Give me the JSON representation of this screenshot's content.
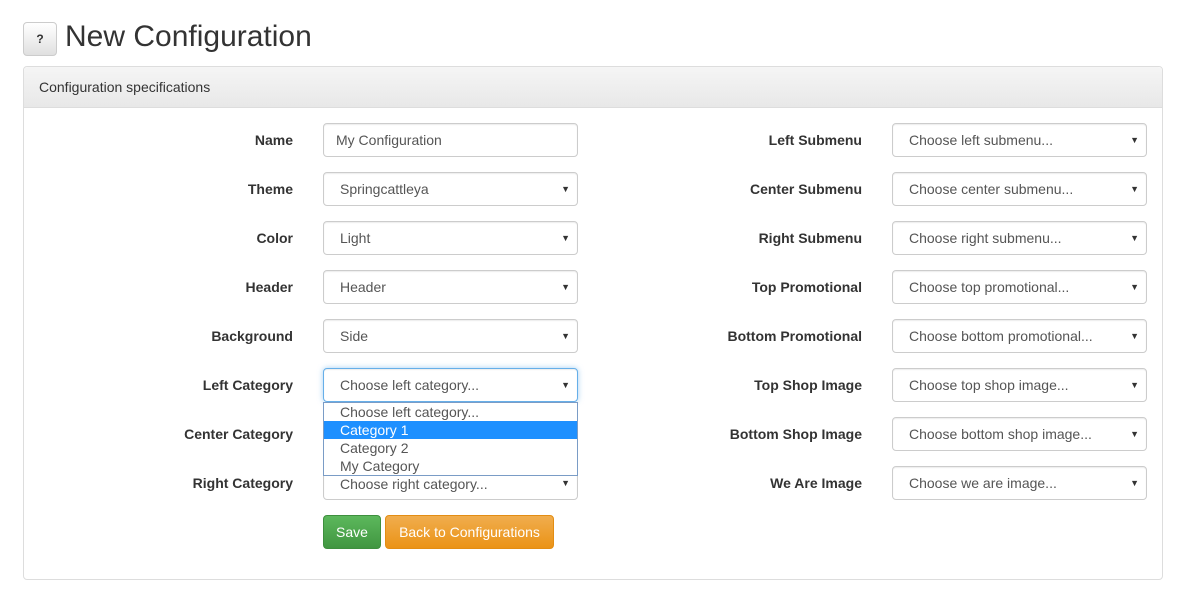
{
  "header": {
    "help_label": "?",
    "title": "New Configuration"
  },
  "panel": {
    "heading": "Configuration specifications"
  },
  "left_fields": [
    {
      "label": "Name",
      "value": "My Configuration",
      "type": "text"
    },
    {
      "label": "Theme",
      "value": "Springcattleya",
      "type": "select"
    },
    {
      "label": "Color",
      "value": "Light",
      "type": "select"
    },
    {
      "label": "Header",
      "value": "Header",
      "type": "select"
    },
    {
      "label": "Background",
      "value": "Side",
      "type": "select"
    },
    {
      "label": "Left Category",
      "value": "Choose left category...",
      "type": "select"
    },
    {
      "label": "Center Category",
      "value": "",
      "type": "select"
    },
    {
      "label": "Right Category",
      "value": "Choose right category...",
      "type": "select"
    }
  ],
  "right_fields": [
    {
      "label": "Left Submenu",
      "value": "Choose left submenu..."
    },
    {
      "label": "Center Submenu",
      "value": "Choose center submenu..."
    },
    {
      "label": "Right Submenu",
      "value": "Choose right submenu..."
    },
    {
      "label": "Top Promotional",
      "value": "Choose top promotional..."
    },
    {
      "label": "Bottom Promotional",
      "value": "Choose bottom promotional..."
    },
    {
      "label": "Top Shop Image",
      "value": "Choose top shop image..."
    },
    {
      "label": "Bottom Shop Image",
      "value": "Choose bottom shop image..."
    },
    {
      "label": "We Are Image",
      "value": "Choose we are image..."
    }
  ],
  "left_category_dropdown": {
    "options": [
      "Choose left category...",
      "Category 1",
      "Category 2",
      "My Category"
    ],
    "highlighted": "Category 1"
  },
  "buttons": {
    "save": "Save",
    "back": "Back to Configurations"
  },
  "colors": {
    "save": "#5cb85c",
    "back": "#f0ad4e",
    "highlight": "#1e90ff"
  }
}
